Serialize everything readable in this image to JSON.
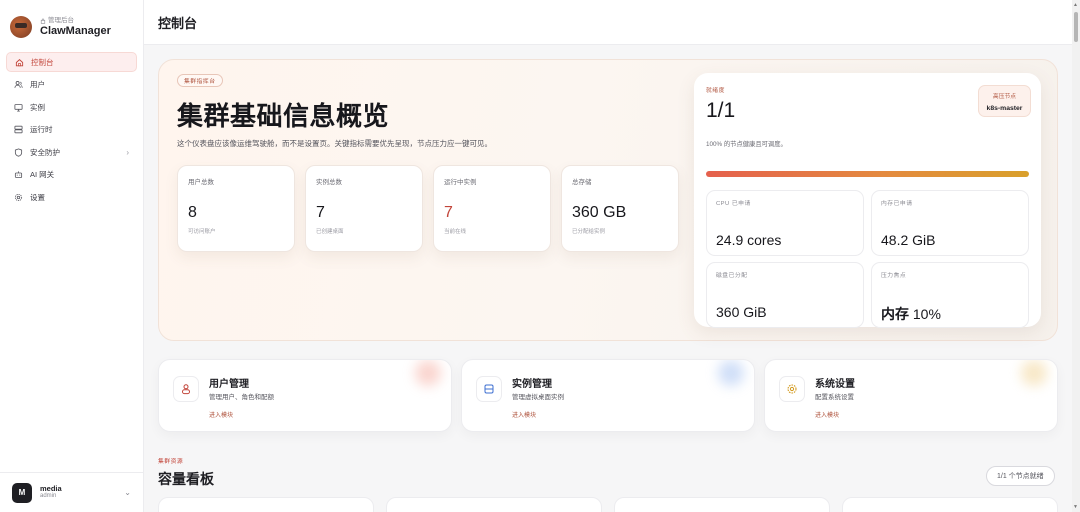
{
  "brand": {
    "subtitle": "管理后台",
    "title": "ClawManager"
  },
  "topbar": {
    "title": "控制台"
  },
  "sidebar": {
    "items": [
      {
        "label": "控制台",
        "icon": "home-icon",
        "active": true
      },
      {
        "label": "用户",
        "icon": "users-icon"
      },
      {
        "label": "实例",
        "icon": "monitor-icon"
      },
      {
        "label": "运行时",
        "icon": "server-icon"
      },
      {
        "label": "安全防护",
        "icon": "shield-icon",
        "has_submenu": true
      },
      {
        "label": "AI 网关",
        "icon": "robot-icon"
      },
      {
        "label": "设置",
        "icon": "gear-icon"
      }
    ]
  },
  "user": {
    "initial": "M",
    "name": "media",
    "role": "admin"
  },
  "hero": {
    "tag": "集群指挥台",
    "title": "集群基础信息概览",
    "description": "这个仪表盘应该像运维驾驶舱，而不是设置页。关键指标需要优先呈现，节点压力应一键可见。",
    "stats": [
      {
        "label": "用户总数",
        "value": "8",
        "sub": "可访问账户"
      },
      {
        "label": "实例总数",
        "value": "7",
        "sub": "已创建桌面"
      },
      {
        "label": "运行中实例",
        "value": "7",
        "sub": "当前在线",
        "highlight": true
      },
      {
        "label": "总存储",
        "value": "360 GB",
        "sub": "已分配给实例"
      }
    ]
  },
  "health": {
    "label": "就绪度",
    "value": "1/1",
    "sub": "100% 的节点健康且可调度。",
    "pressure_label": "高压节点",
    "pressure_value": "k8s-master",
    "readiness_fraction": 1.0,
    "metrics": [
      {
        "label": "CPU 已申请",
        "value": "24.9 cores"
      },
      {
        "label": "内存已申请",
        "value": "48.2 GiB"
      },
      {
        "label": "磁盘已分配",
        "value": "360 GiB"
      },
      {
        "label": "压力焦点",
        "value_bold": "内存",
        "value_rest": " 10%"
      }
    ]
  },
  "modules": [
    {
      "title": "用户管理",
      "desc": "管理用户、角色和配额",
      "link": "进入模块",
      "icon": "users-icon",
      "accent": "#f6b3a8"
    },
    {
      "title": "实例管理",
      "desc": "管理虚拟桌面实例",
      "link": "进入模块",
      "icon": "server-icon",
      "accent": "#a9c4f2"
    },
    {
      "title": "系统设置",
      "desc": "配置系统设置",
      "link": "进入模块",
      "icon": "gear-icon",
      "accent": "#f2d59a"
    }
  ],
  "capacity": {
    "label": "集群资源",
    "title": "容量看板",
    "pill": "1/1 个节点就绪"
  },
  "colors": {
    "accent": "#c2453a",
    "brand_orange": "#e48a3f"
  }
}
